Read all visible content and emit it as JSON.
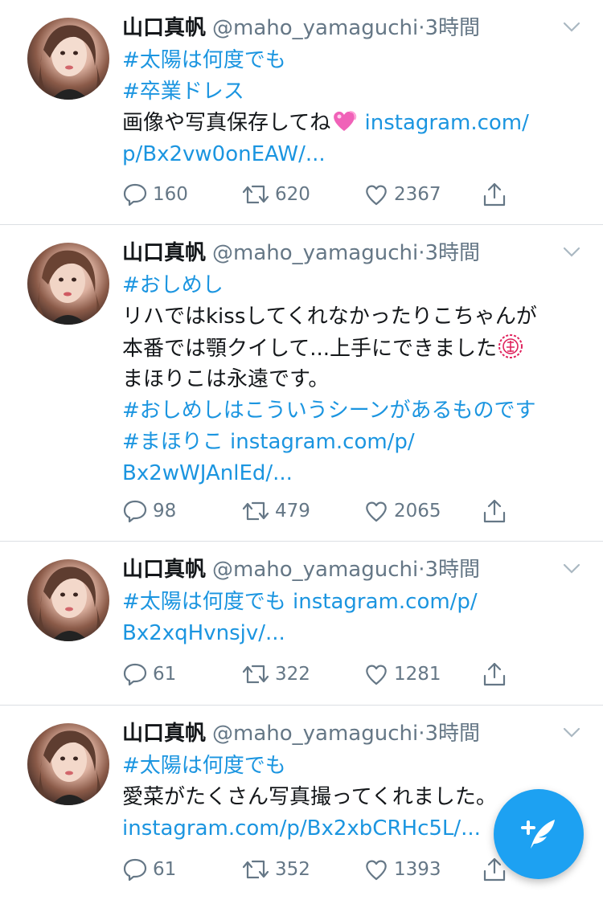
{
  "tweets": [
    {
      "author": "山口真帆",
      "handle": "@maho_yamaguchi",
      "separator": "·",
      "time": "3時間",
      "lines": [
        {
          "link": "#太陽は何度でも"
        },
        {
          "link": "#卒業ドレス"
        },
        {
          "text": "画像や写真保存してね",
          "emoji": "heart-emoji",
          "link": " instagram.com/"
        },
        {
          "link": "p/Bx2vw0onEAW/..."
        }
      ],
      "replies": "160",
      "retweets": "620",
      "likes": "2367"
    },
    {
      "author": "山口真帆",
      "handle": "@maho_yamaguchi",
      "separator": "·",
      "time": "3時間",
      "lines": [
        {
          "link": "#おしめし"
        },
        {
          "text": "リハではkissしてくれなかったりこちゃんが"
        },
        {
          "text": "本番では顎クイして...上手にできました",
          "emoji": "seal-emoji"
        },
        {
          "text": "まほりこは永遠です。"
        },
        {
          "link": "#おしめしはこういうシーンがあるものです"
        },
        {
          "link": "#まほりこ instagram.com/p/"
        },
        {
          "link": "Bx2wWJAnlEd/..."
        }
      ],
      "replies": "98",
      "retweets": "479",
      "likes": "2065"
    },
    {
      "author": "山口真帆",
      "handle": "@maho_yamaguchi",
      "separator": "·",
      "time": "3時間",
      "lines": [
        {
          "link": "#太陽は何度でも instagram.com/p/"
        },
        {
          "link": "Bx2xqHvnsjv/..."
        }
      ],
      "replies": "61",
      "retweets": "322",
      "likes": "1281"
    },
    {
      "author": "山口真帆",
      "handle": "@maho_yamaguchi",
      "separator": "·",
      "time": "3時間",
      "lines": [
        {
          "link": "#太陽は何度でも"
        },
        {
          "text": "愛菜がたくさん写真撮ってくれました。"
        },
        {
          "link": "instagram.com/p/Bx2xbCRHc5L/..."
        }
      ],
      "replies": "61",
      "retweets": "352",
      "likes": "1393"
    }
  ],
  "icons": {
    "reply": "reply-icon",
    "retweet": "retweet-icon",
    "like": "heart-icon",
    "share": "share-icon",
    "more": "chevron-down-icon",
    "compose": "compose-tweet-icon"
  },
  "colors": {
    "link": "#1b95e0",
    "text": "#14171a",
    "muted": "#657786",
    "fab": "#1da1f2"
  }
}
